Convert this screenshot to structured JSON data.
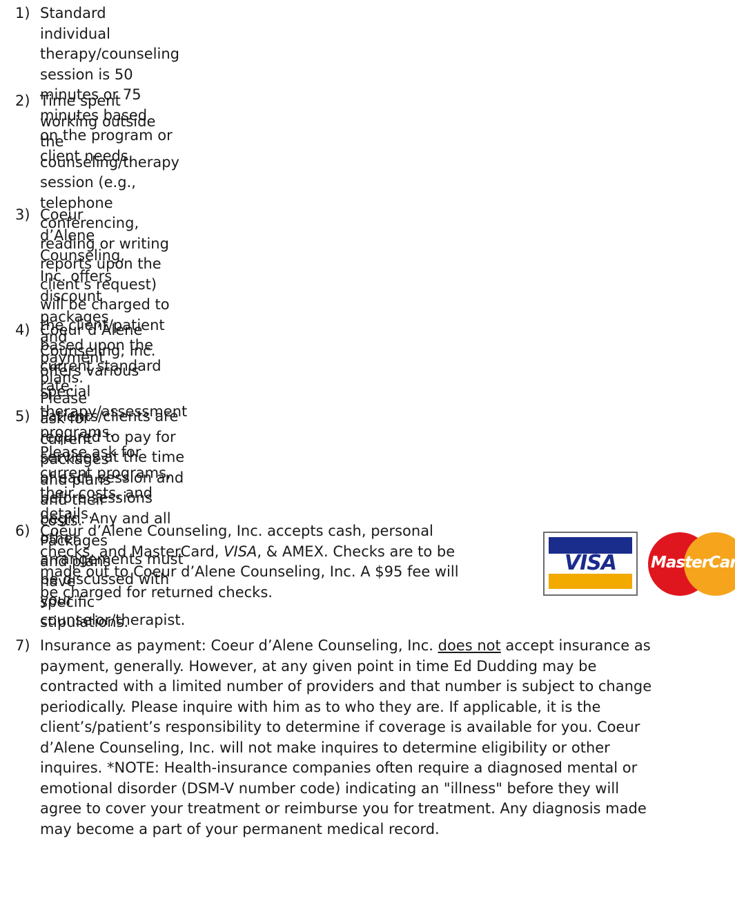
{
  "items": [
    {
      "num": "1)",
      "lines": [
        "Standard individual therapy/counseling session is 50 minutes or 75 minutes based",
        "on the program or client needs."
      ]
    },
    {
      "num": "2)",
      "lines": [
        "Time spent working outside the counseling/therapy session (e.g., telephone",
        "conferencing, reading or writing reports upon the client's request) will be charged to",
        "the client/patient based upon the current standard rate."
      ]
    },
    {
      "num": "3)",
      "lines": [
        "Coeur d’Alene Counseling, Inc. offers discount packages and payment plans. Please",
        "ask for current packages and plans and their costs. Packages and plans have specific",
        "stipulations."
      ]
    },
    {
      "num": "4)",
      "lines": [
        "Coeur d’Alene Counseling, Inc. offers various special therapy/assessment programs.",
        "Please ask for current programs, their costs, and details."
      ]
    },
    {
      "num": "5)",
      "lines": [
        "Patients/clients are required to pay for services at the time of each session and",
        "before sessions begin. Any and all other arrangements must be discussed with your",
        "counselor/therapist."
      ]
    },
    {
      "num": "6)",
      "line1": "Coeur d’Alene Counseling, Inc. accepts cash, personal",
      "line2_a": "checks, and MasterCard, ",
      "line2_visa": "VISA",
      "line2_b": ", & AMEX. Checks are to be",
      "line3": "made out to Coeur d’Alene Counseling, Inc. A $95 fee will",
      "line4": "be charged for returned checks."
    },
    {
      "num": "7)",
      "line1_a": "Insurance as payment: Coeur d’Alene Counseling, Inc. ",
      "line1_u": "does not",
      "line1_b": " accept insurance as",
      "lines": [
        "payment, generally. However, at any given point in time Ed Dudding may be",
        "contracted with a limited number of providers and that number is subject to change",
        "periodically. Please inquire with him as to who they are. If applicable, it is the",
        "client’s/patient’s responsibility to determine if coverage is available for you. Coeur",
        "d’Alene Counseling, Inc. will not make inquires to determine eligibility or other",
        "inquires.  *NOTE: Health-insurance companies often require a diagnosed mental or",
        "emotional disorder (DSM-V number code) indicating an \"illness\" before they will",
        "agree to cover your treatment or reimburse you for treatment. Any diagnosis made",
        "may become a part of your permanent medical record."
      ]
    }
  ],
  "logos": {
    "visa": "VISA",
    "mastercard": "MasterCard",
    "colors": {
      "visa_blue": "#1a2c8c",
      "visa_gold": "#f2a900",
      "mc_red": "#e0161f",
      "mc_yellow": "#f5a41c"
    }
  }
}
